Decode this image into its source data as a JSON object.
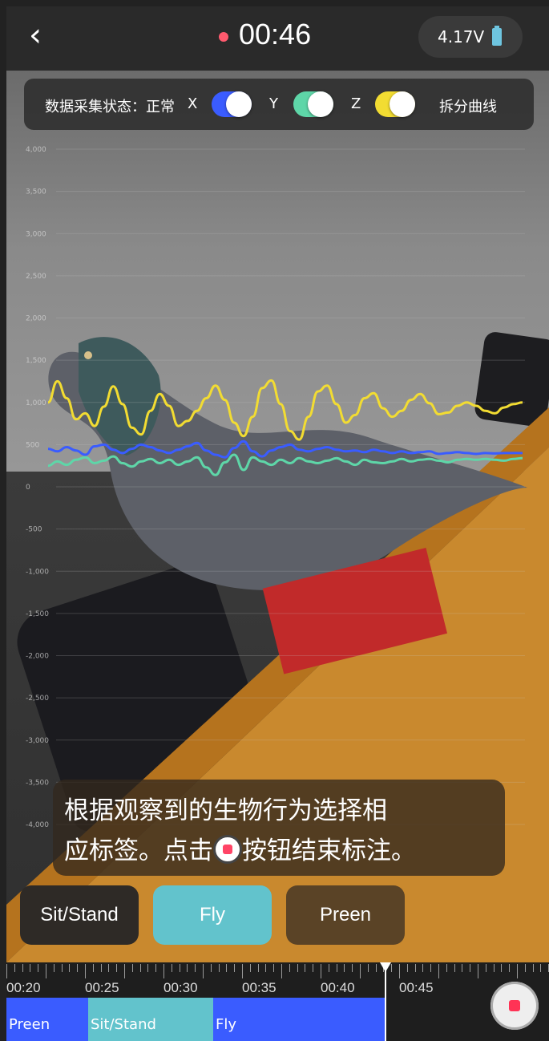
{
  "topbar": {
    "timer": "00:46",
    "battery": "4.17V"
  },
  "status": {
    "label": "数据采集状态：正常",
    "x_label": "X",
    "y_label": "Y",
    "z_label": "Z",
    "split_label": "拆分曲线",
    "colors": {
      "x": "#3a5cff",
      "y": "#5ed6a8",
      "z": "#f2dc32"
    }
  },
  "chart_data": {
    "type": "line",
    "y_ticks": [
      "4,000",
      "3,500",
      "3,000",
      "2,500",
      "2,000",
      "1,500",
      "1,000",
      "500",
      "0",
      "-500",
      "-1,000",
      "-1,500",
      "-2,000",
      "-2,500",
      "-3,000",
      "-3,500",
      "-4,000"
    ],
    "ylim": [
      -4000,
      4000
    ],
    "grid": true,
    "series": [
      {
        "name": "Z",
        "color": "#f2dc32",
        "values": [
          1000,
          1250,
          1050,
          800,
          870,
          720,
          950,
          1190,
          980,
          700,
          620,
          900,
          1100,
          960,
          720,
          780,
          900,
          1050,
          1200,
          1030,
          760,
          600,
          830,
          1170,
          1260,
          980,
          660,
          560,
          830,
          1130,
          1200,
          980,
          760,
          850,
          1050,
          1110,
          930,
          830,
          900,
          1030,
          1100,
          990,
          860,
          880,
          960,
          1000,
          960,
          900,
          870,
          940,
          980,
          1000
        ]
      },
      {
        "name": "X",
        "color": "#3a5cff",
        "values": [
          450,
          420,
          470,
          430,
          380,
          480,
          500,
          440,
          400,
          450,
          500,
          470,
          430,
          400,
          440,
          480,
          520,
          430,
          380,
          350,
          460,
          540,
          420,
          360,
          430,
          470,
          500,
          440,
          420,
          450,
          470,
          440,
          420,
          430,
          410,
          440,
          420,
          400,
          420,
          400,
          410,
          420,
          390,
          400,
          410,
          400,
          390,
          400,
          395,
          400,
          400,
          400
        ]
      },
      {
        "name": "Y",
        "color": "#5ed6a8",
        "values": [
          250,
          300,
          260,
          320,
          350,
          280,
          310,
          360,
          280,
          240,
          300,
          330,
          280,
          320,
          260,
          300,
          350,
          230,
          140,
          290,
          380,
          200,
          350,
          300,
          260,
          320,
          280,
          340,
          300,
          280,
          310,
          340,
          300,
          260,
          320,
          290,
          280,
          300,
          330,
          300,
          320,
          330,
          310,
          290,
          320,
          330,
          320,
          330,
          320,
          310,
          330,
          340
        ]
      }
    ]
  },
  "hint": {
    "line1": "根据观察到的生物行为选择相",
    "line2a": "应标签。点击",
    "line2b": "按钮结束标注。"
  },
  "labels": [
    {
      "text": "Sit/Stand",
      "bg": "#2e2a26"
    },
    {
      "text": "Fly",
      "bg": "#62c3cc"
    },
    {
      "text": "Preen",
      "bg": "#5a4326"
    }
  ],
  "timeline": {
    "times": [
      "00:20",
      "00:25",
      "00:30",
      "00:35",
      "00:40",
      "00:45"
    ],
    "segments": [
      {
        "text": "Preen",
        "color": "#3a5cff"
      },
      {
        "text": "Sit/Stand",
        "color": "#62c3cc"
      },
      {
        "text": "Fly",
        "color": "#3a5cff"
      }
    ]
  }
}
